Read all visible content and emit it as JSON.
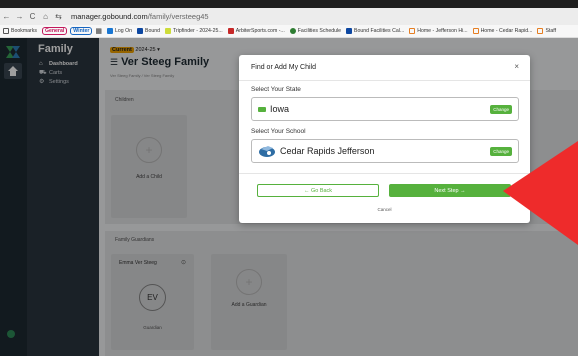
{
  "browser": {
    "nav_back": "←",
    "nav_forward": "→",
    "nav_reload": "C",
    "nav_home": "⌂",
    "url_host": "manager.gobound.com",
    "url_path": "/family/versteeg45",
    "bookmarks_label": "Bookmarks",
    "tag_general": "General",
    "tag_winter": "Winter",
    "bookmarks": [
      "Log On",
      "Bound",
      "Tripfinder - 2024-25...",
      "ArbiterSports.com -...",
      "Facilities Schedule",
      "Bound Facilities Cal...",
      "Home - Jefferson Hi...",
      "Home - Cedar Rapid...",
      "Staff"
    ]
  },
  "sidebar": {
    "title": "Family",
    "items": [
      {
        "label": "Dashboard",
        "icon": "home-icon"
      },
      {
        "label": "Carts",
        "icon": "cart-icon"
      },
      {
        "label": "Settings",
        "icon": "gear-icon"
      }
    ]
  },
  "main": {
    "season_badge": "Current",
    "season_label": "2024-25",
    "family_title": "Ver Steeg Family",
    "breadcrumb": "Ver Steeg Family / Ver Steeg Family",
    "children_panel_title": "Children",
    "add_child_label": "Add a Child",
    "guardians_panel_title": "Family Guardians",
    "guardian_name": "Emma Ver Steeg",
    "guardian_initials": "EV",
    "guardian_role": "Guardian",
    "add_guardian_label": "Add a Guardian"
  },
  "modal": {
    "title": "Find or Add My Child",
    "close": "×",
    "state_label": "Select Your State",
    "state_value": "Iowa",
    "school_label": "Select Your School",
    "school_value": "Cedar Rapids Jefferson",
    "change_label": "Change",
    "back_label": "← Go Back",
    "next_label": "Next Step →",
    "cancel_label": "Cancel"
  },
  "colors": {
    "accent_green": "#56b13d",
    "sidebar_dark": "#2b3640",
    "annotation_red": "#ee2b2b",
    "season_orange": "#f2a400"
  }
}
